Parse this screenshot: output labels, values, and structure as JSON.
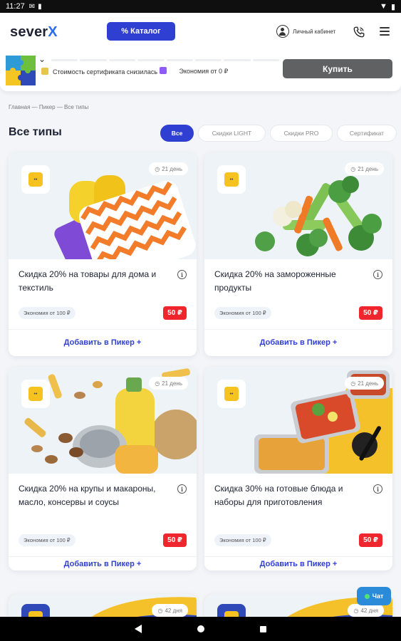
{
  "status_bar": {
    "time": "11:27"
  },
  "header": {
    "logo_main": "sever",
    "logo_x": "X",
    "catalog_label": "% Каталог",
    "account_label": "Личный кабинет"
  },
  "banner": {
    "promo_text": "Стоимость сертификата снизилась",
    "economy_text": "Экономия от 0 ₽",
    "buy_label": "Купить"
  },
  "breadcrumb": "Главная — Пикер — Все типы",
  "page_title": "Все типы",
  "filters": [
    {
      "label": "Все",
      "active": true
    },
    {
      "label": "Скидки LIGHT",
      "active": false
    },
    {
      "label": "Скидки PRO",
      "active": false
    },
    {
      "label": "Сертификат",
      "active": false
    }
  ],
  "cards": [
    {
      "days": "21 день",
      "title": "Скидка 20% на товары для дома и текстиль",
      "economy": "Экономия от 100 ₽",
      "price": "50 ₽",
      "add_label": "Добавить в Пикер +"
    },
    {
      "days": "21 день",
      "title": "Скидка 20% на замороженные продукты",
      "economy": "Экономия от 100 ₽",
      "price": "50 ₽",
      "add_label": "Добавить в Пикер +"
    },
    {
      "days": "21 день",
      "title": "Скидка 20% на крупы и макароны, масло, консервы и соусы",
      "economy": "Экономия от 100 ₽",
      "price": "50 ₽",
      "add_label": "Добавить в Пикер +"
    },
    {
      "days": "21 день",
      "title": "Скидка 30% на готовые блюда и наборы для приготовления",
      "economy": "Экономия от 100 ₽",
      "price": "50 ₽",
      "add_label": "Добавить в Пикер +"
    },
    {
      "days": "42 дня"
    },
    {
      "days": "42 дня"
    }
  ],
  "chat_label": "Чат"
}
